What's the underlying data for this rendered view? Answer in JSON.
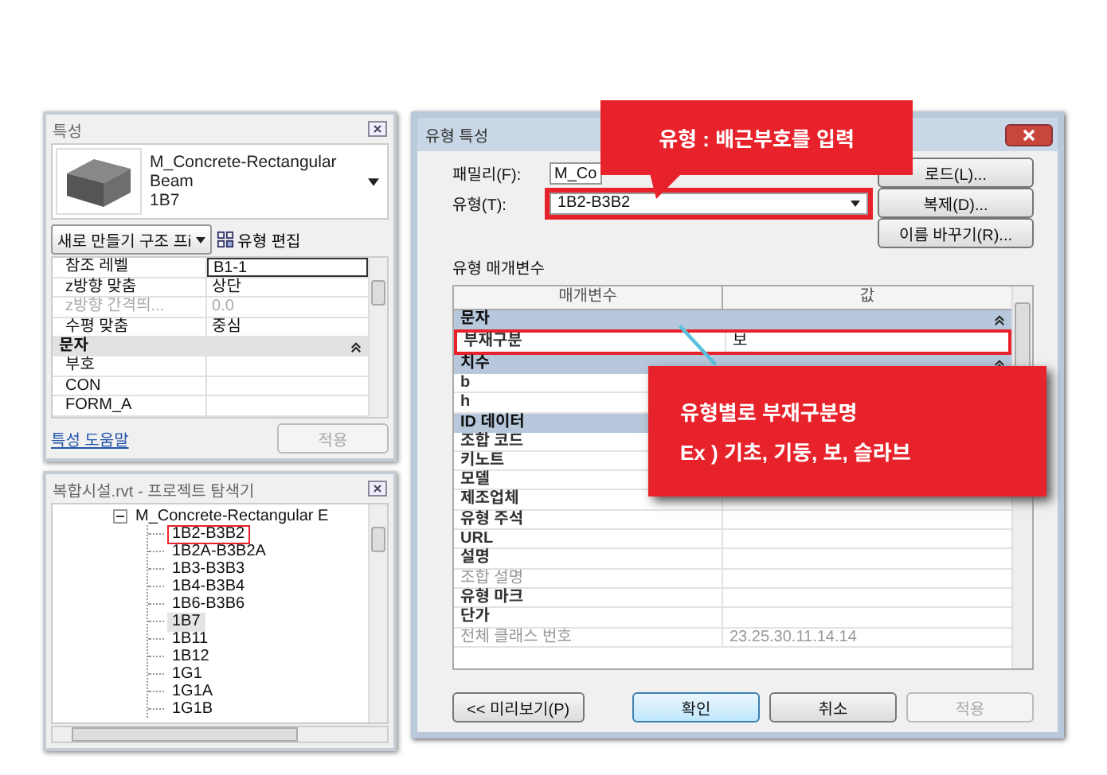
{
  "properties_panel": {
    "title": "특성",
    "family_name": "M_Concrete-Rectangular",
    "family_sub": "Beam",
    "type_name": "1B7",
    "new_dropdown": "새로 만들기 구조 프i",
    "edit_type_button": "유형 편집",
    "rows": [
      {
        "kind": "param",
        "name": "참조 레벨",
        "value": "B1-1",
        "selected": true,
        "disabled": false
      },
      {
        "kind": "param",
        "name": "z방향 맞춤",
        "value": "상단",
        "selected": false,
        "disabled": false
      },
      {
        "kind": "param",
        "name": "z방향 간격띄...",
        "value": "0.0",
        "selected": false,
        "disabled": true
      },
      {
        "kind": "param",
        "name": "수평 맞춤",
        "value": "중심",
        "selected": false,
        "disabled": false
      },
      {
        "kind": "group",
        "name": "문자",
        "expanded": true
      },
      {
        "kind": "param",
        "name": "부호",
        "selected": false,
        "disabled": false
      },
      {
        "kind": "param",
        "name": "CON",
        "selected": false,
        "disabled": false
      },
      {
        "kind": "param",
        "name": "FORM_A",
        "selected": false,
        "disabled": false
      }
    ],
    "help_link": "특성 도움말",
    "apply_button": {
      "label": "적용",
      "disabled": true
    }
  },
  "browser": {
    "title": "복합시설.rvt - 프로젝트 탐색기",
    "parent": {
      "label": "M_Concrete-Rectangular E",
      "expanded": true,
      "children": [
        {
          "label": "1B2-B3B2",
          "selected": false,
          "highlighted": true
        },
        {
          "label": "1B2A-B3B2A",
          "selected": false,
          "highlighted": false
        },
        {
          "label": "1B3-B3B3",
          "selected": false,
          "highlighted": false
        },
        {
          "label": "1B4-B3B4",
          "selected": false,
          "highlighted": false
        },
        {
          "label": "1B6-B3B6",
          "selected": false,
          "highlighted": false
        },
        {
          "label": "1B7",
          "selected": true,
          "highlighted": false
        },
        {
          "label": "1B11",
          "selected": false,
          "highlighted": false
        },
        {
          "label": "1B12",
          "selected": false,
          "highlighted": false
        },
        {
          "label": "1G1",
          "selected": false,
          "highlighted": false
        },
        {
          "label": "1G1A",
          "selected": false,
          "highlighted": false
        },
        {
          "label": "1G1B",
          "selected": false,
          "highlighted": false
        }
      ]
    }
  },
  "dialog": {
    "title": "유형 특성",
    "family_label": "패밀리(F):",
    "family_value": "M_Co",
    "load_button": "로드(L)...",
    "type_label": "유형(T):",
    "type_value": "1B2-B3B2",
    "type_highlighted": true,
    "duplicate_button": "복제(D)...",
    "rename_button": "이름 바꾸기(R)...",
    "params_label": "유형 매개변수",
    "columns": [
      "매개변수",
      "값"
    ],
    "rows": [
      {
        "kind": "group",
        "name": "문자",
        "expanded": true
      },
      {
        "kind": "param",
        "name": "부재구분",
        "value": "보",
        "highlighted": true,
        "disabled": false
      },
      {
        "kind": "group",
        "name": "치수",
        "expanded": true
      },
      {
        "kind": "param",
        "name": "b",
        "highlighted": false,
        "disabled": false
      },
      {
        "kind": "param",
        "name": "h",
        "highlighted": false,
        "disabled": false
      },
      {
        "kind": "group",
        "name": "ID 데이터"
      },
      {
        "kind": "param",
        "name": "조합 코드",
        "highlighted": false,
        "disabled": false
      },
      {
        "kind": "param",
        "name": "키노트",
        "highlighted": false,
        "disabled": false
      },
      {
        "kind": "param",
        "name": "모델",
        "highlighted": false,
        "disabled": false
      },
      {
        "kind": "param",
        "name": "제조업체",
        "highlighted": false,
        "disabled": false
      },
      {
        "kind": "param",
        "name": "유형 주석",
        "highlighted": false,
        "disabled": false
      },
      {
        "kind": "param",
        "name": "URL",
        "highlighted": false,
        "disabled": false
      },
      {
        "kind": "param",
        "name": "설명",
        "highlighted": false,
        "disabled": false
      },
      {
        "kind": "param",
        "name": "조합 설명",
        "highlighted": false,
        "disabled": true
      },
      {
        "kind": "param",
        "name": "유형 마크",
        "highlighted": false,
        "disabled": false
      },
      {
        "kind": "param",
        "name": "단가",
        "highlighted": false,
        "disabled": false
      },
      {
        "kind": "param",
        "name": "전체 클래스 번호",
        "value": "23.25.30.11.14.14",
        "highlighted": false,
        "disabled": true
      }
    ],
    "preview_button": "<< 미리보기(P)",
    "ok_button": "확인",
    "cancel_button": "취소",
    "apply_button": {
      "label": "적용",
      "disabled": true
    }
  },
  "callouts": [
    {
      "text": "유형 : 배근부호를 입력"
    },
    {
      "lines": [
        "유형별로 부재구분명",
        "Ex ) 기초, 기둥, 보, 슬라브"
      ]
    }
  ]
}
